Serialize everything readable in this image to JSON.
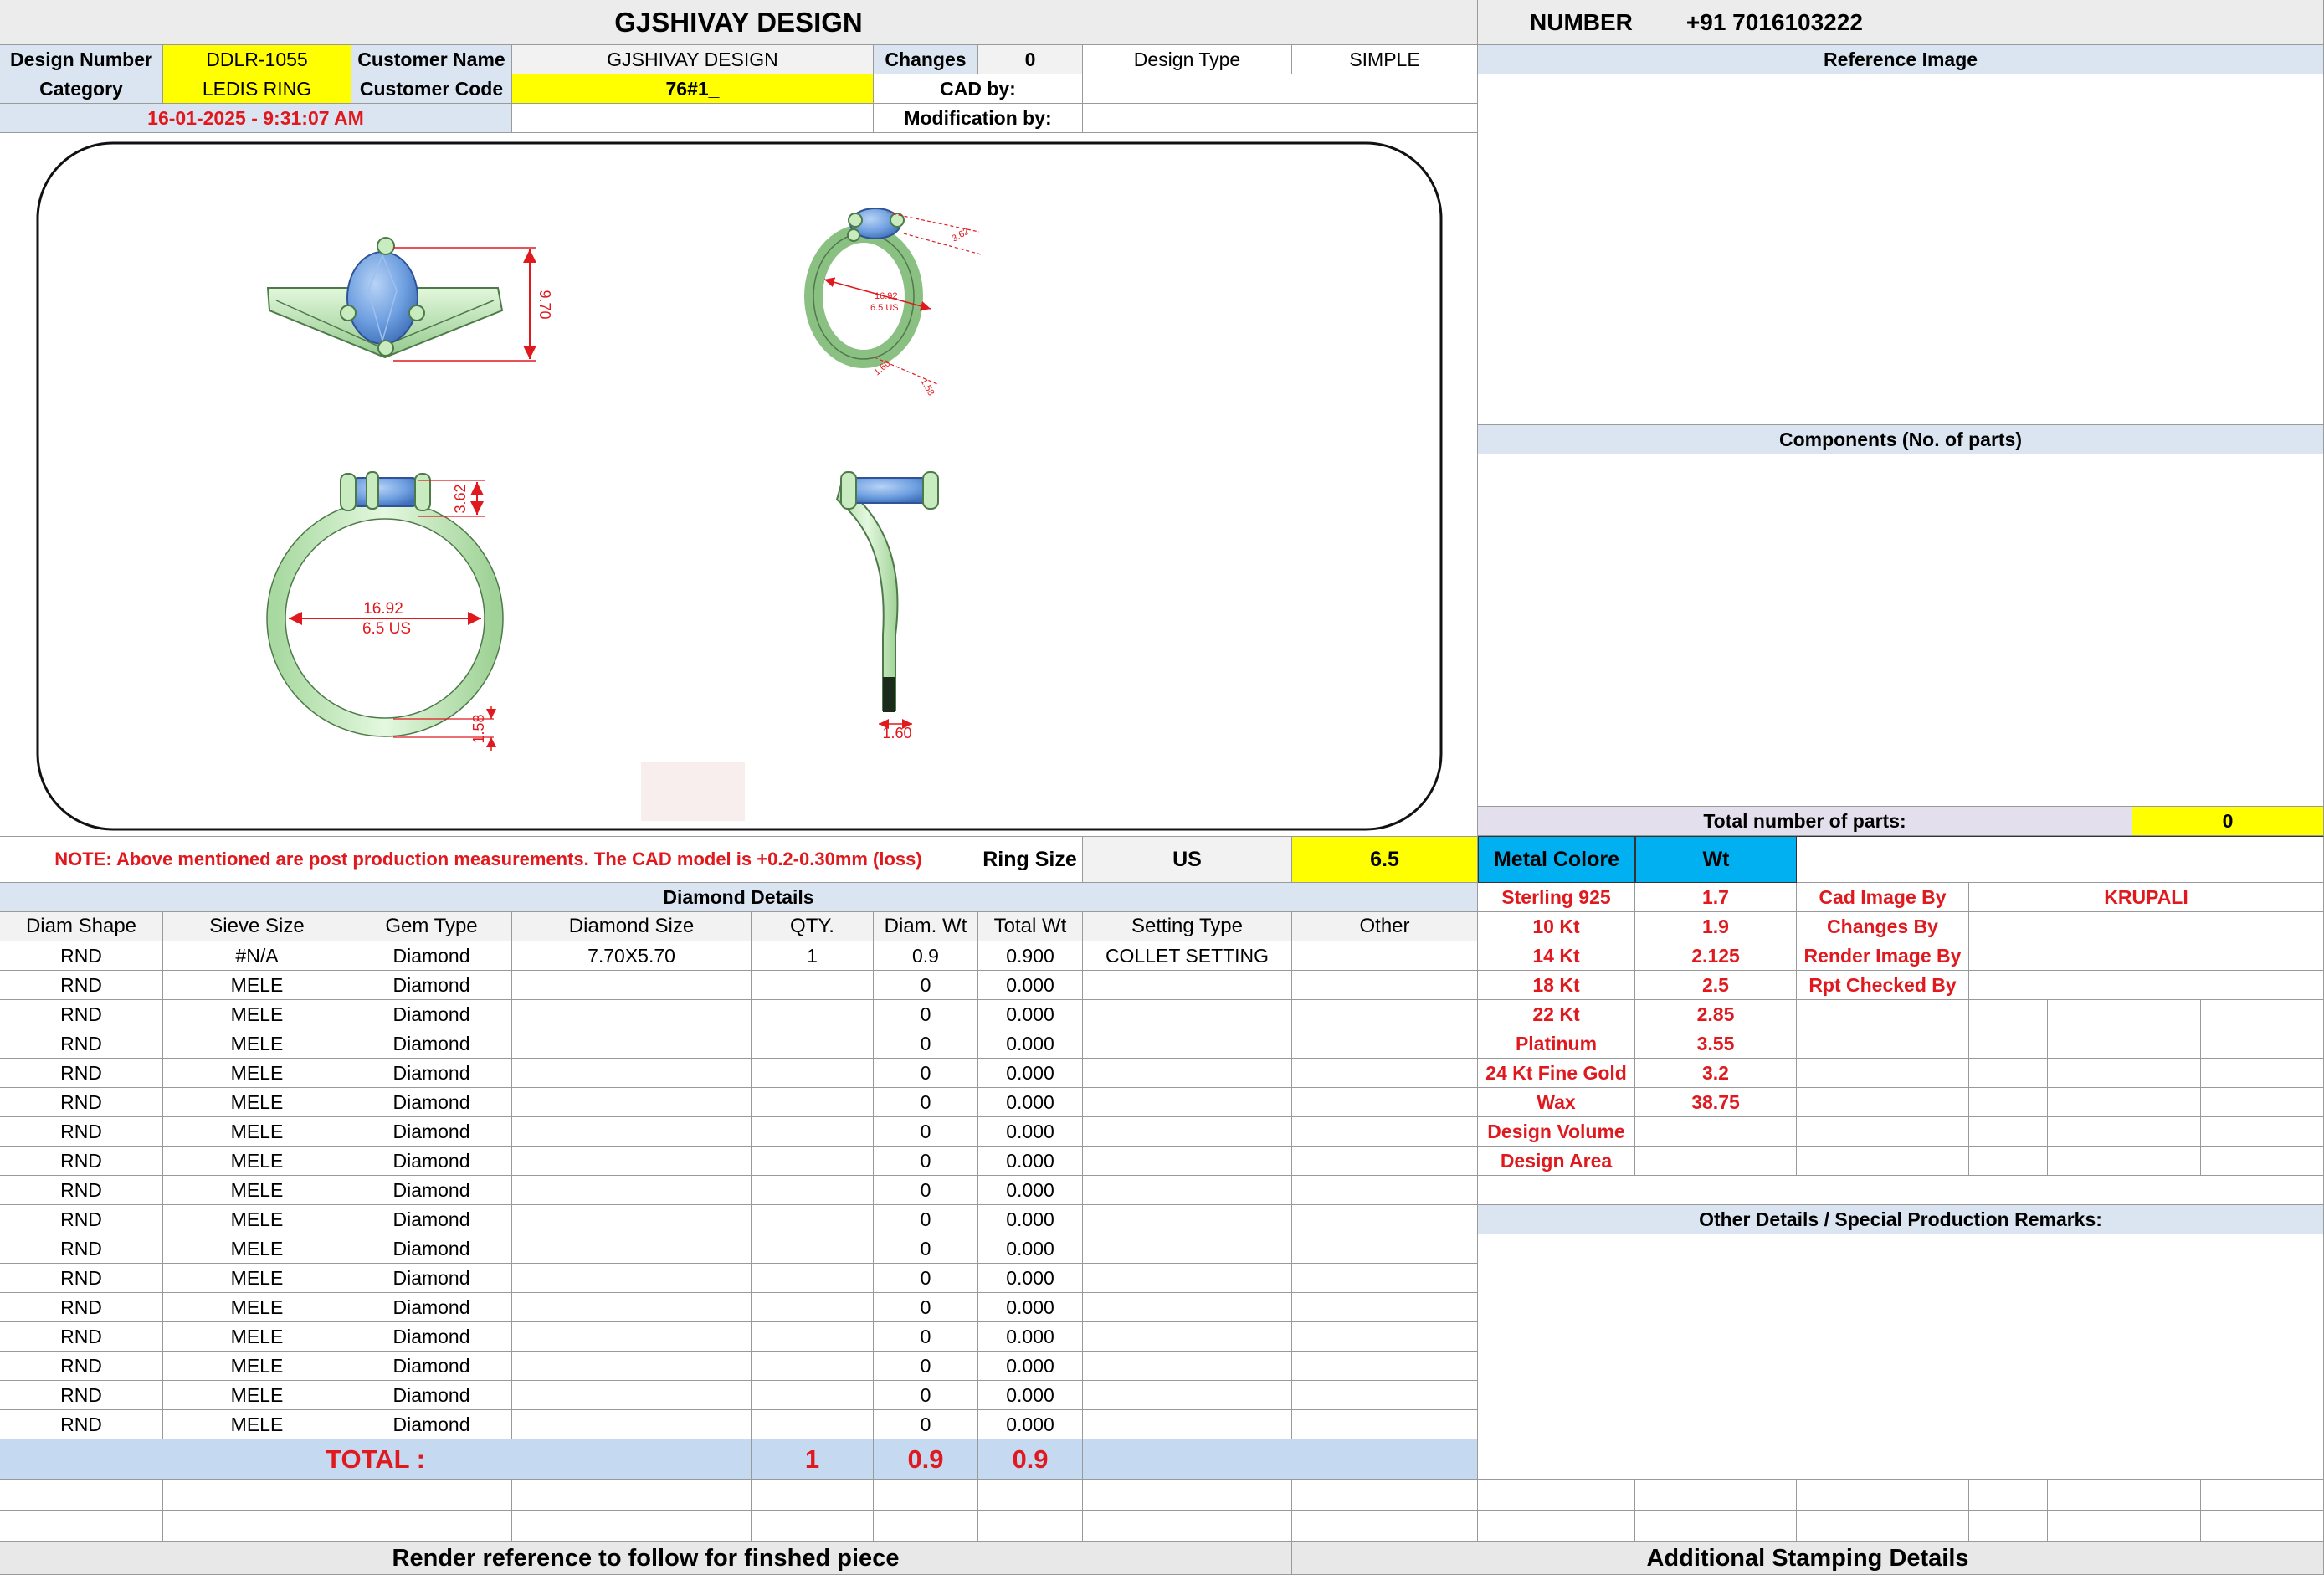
{
  "header": {
    "company": "GJSHIVAY DESIGN",
    "number_label": "NUMBER",
    "phone": "+91 7016103222"
  },
  "info": {
    "design_number_label": "Design Number",
    "design_number": "DDLR-1055",
    "customer_name_label": "Customer Name",
    "customer_name": "GJSHIVAY DESIGN",
    "changes_label": "Changes",
    "changes": "0",
    "design_type_label": "Design Type",
    "design_type": "SIMPLE",
    "category_label": "Category",
    "category": "LEDIS RING",
    "customer_code_label": "Customer Code",
    "customer_code": "76#1_",
    "cad_by_label": "CAD by:",
    "modification_by_label": "Modification by:",
    "datetime": "16-01-2025 - 9:31:07 AM"
  },
  "drawing": {
    "dim_height": "9.70",
    "dim_top": "3.62",
    "dim_inner": "16.92",
    "dim_size": "6.5 US",
    "dim_bottom": "1.58",
    "dim_side": "1.60",
    "iso_a": "16.92",
    "iso_b": "6.5 US",
    "iso_c": "1.58",
    "iso_d": "3.62",
    "iso_e": "1.60"
  },
  "note": {
    "text": "NOTE: Above mentioned are post production measurements. The CAD model is +0.2-0.30mm (loss)",
    "ring_size_label": "Ring Size",
    "ring_size_unit": "US",
    "ring_size": "6.5"
  },
  "diamond": {
    "title": "Diamond Details",
    "headers": [
      "Diam Shape",
      "Sieve Size",
      "Gem Type",
      "Diamond Size",
      "QTY.",
      "Diam. Wt",
      "Total Wt",
      "Setting Type",
      "Other"
    ],
    "rows": [
      [
        "RND",
        "#N/A",
        "Diamond",
        "7.70X5.70",
        "1",
        "0.9",
        "0.900",
        "COLLET SETTING",
        ""
      ],
      [
        "RND",
        "MELE",
        "Diamond",
        "",
        "",
        "0",
        "0.000",
        "",
        ""
      ],
      [
        "RND",
        "MELE",
        "Diamond",
        "",
        "",
        "0",
        "0.000",
        "",
        ""
      ],
      [
        "RND",
        "MELE",
        "Diamond",
        "",
        "",
        "0",
        "0.000",
        "",
        ""
      ],
      [
        "RND",
        "MELE",
        "Diamond",
        "",
        "",
        "0",
        "0.000",
        "",
        ""
      ],
      [
        "RND",
        "MELE",
        "Diamond",
        "",
        "",
        "0",
        "0.000",
        "",
        ""
      ],
      [
        "RND",
        "MELE",
        "Diamond",
        "",
        "",
        "0",
        "0.000",
        "",
        ""
      ],
      [
        "RND",
        "MELE",
        "Diamond",
        "",
        "",
        "0",
        "0.000",
        "",
        ""
      ],
      [
        "RND",
        "MELE",
        "Diamond",
        "",
        "",
        "0",
        "0.000",
        "",
        ""
      ],
      [
        "RND",
        "MELE",
        "Diamond",
        "",
        "",
        "0",
        "0.000",
        "",
        ""
      ],
      [
        "RND",
        "MELE",
        "Diamond",
        "",
        "",
        "0",
        "0.000",
        "",
        ""
      ],
      [
        "RND",
        "MELE",
        "Diamond",
        "",
        "",
        "0",
        "0.000",
        "",
        ""
      ],
      [
        "RND",
        "MELE",
        "Diamond",
        "",
        "",
        "0",
        "0.000",
        "",
        ""
      ],
      [
        "RND",
        "MELE",
        "Diamond",
        "",
        "",
        "0",
        "0.000",
        "",
        ""
      ],
      [
        "RND",
        "MELE",
        "Diamond",
        "",
        "",
        "0",
        "0.000",
        "",
        ""
      ],
      [
        "RND",
        "MELE",
        "Diamond",
        "",
        "",
        "0",
        "0.000",
        "",
        ""
      ],
      [
        "RND",
        "MELE",
        "Diamond",
        "",
        "",
        "0",
        "0.000",
        "",
        ""
      ]
    ],
    "total_label": "TOTAL :",
    "total_qty": "1",
    "total_diam_wt": "0.9",
    "total_wt": "0.9"
  },
  "right": {
    "reference_image_label": "Reference Image",
    "components_label": "Components (No. of parts)",
    "total_parts_label": "Total number of parts:",
    "total_parts": "0",
    "metal_color_label": "Metal Colore",
    "wt_label": "Wt",
    "metals": [
      {
        "name": "Sterling 925",
        "wt": "1.7"
      },
      {
        "name": "10 Kt",
        "wt": "1.9"
      },
      {
        "name": "14 Kt",
        "wt": "2.125"
      },
      {
        "name": "18 Kt",
        "wt": "2.5"
      },
      {
        "name": "22 Kt",
        "wt": "2.85"
      },
      {
        "name": "Platinum",
        "wt": "3.55"
      },
      {
        "name": "24 Kt Fine Gold",
        "wt": "3.2"
      },
      {
        "name": "Wax",
        "wt": "38.75"
      },
      {
        "name": "Design Volume",
        "wt": ""
      },
      {
        "name": "Design Area",
        "wt": ""
      }
    ],
    "credits": [
      {
        "label": "Cad Image By",
        "value": "KRUPALI"
      },
      {
        "label": "Changes By",
        "value": ""
      },
      {
        "label": "Render Image By",
        "value": ""
      },
      {
        "label": "Rpt Checked By",
        "value": ""
      }
    ],
    "remarks_label": "Other Details / Special Production Remarks:"
  },
  "footer": {
    "left": "Render reference to follow for finshed piece",
    "right": "Additional Stamping Details"
  },
  "colors": {
    "highlight_yellow": "#ffff00",
    "header_blue": "#dbe5f1",
    "total_blue": "#c5d9f1",
    "metal_cyan": "#00b0f0",
    "text_red": "#e0191e",
    "ring_green": "#c8ecc0",
    "stone_blue": "#6e9fe0"
  }
}
